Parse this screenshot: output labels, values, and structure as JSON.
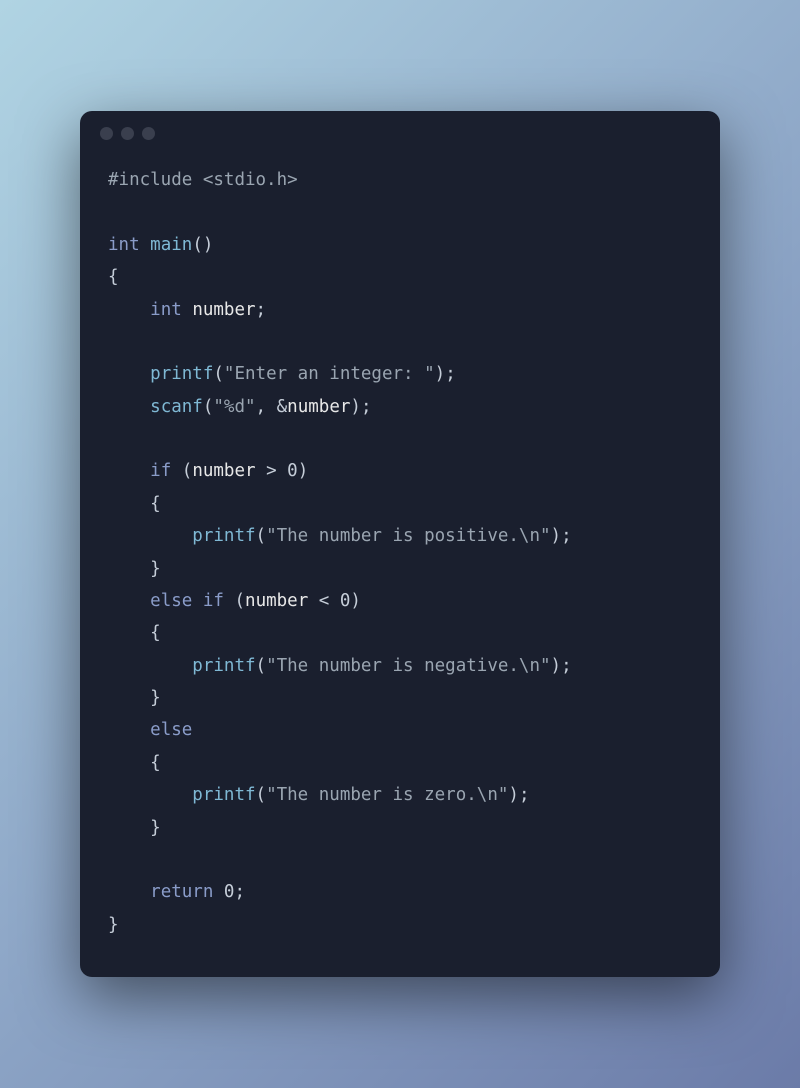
{
  "code": {
    "tokens": [
      [
        {
          "t": "#include",
          "c": "c-preprocessor"
        },
        {
          "t": " ",
          "c": "c-text"
        },
        {
          "t": "<stdio.h>",
          "c": "c-include-path"
        }
      ],
      [],
      [
        {
          "t": "int",
          "c": "c-type"
        },
        {
          "t": " ",
          "c": "c-text"
        },
        {
          "t": "main",
          "c": "c-function"
        },
        {
          "t": "()",
          "c": "c-paren"
        }
      ],
      [
        {
          "t": "{",
          "c": "c-brace"
        }
      ],
      [
        {
          "t": "    ",
          "c": "c-text"
        },
        {
          "t": "int",
          "c": "c-type"
        },
        {
          "t": " ",
          "c": "c-text"
        },
        {
          "t": "number",
          "c": "c-identifier"
        },
        {
          "t": ";",
          "c": "c-punctuation"
        }
      ],
      [],
      [
        {
          "t": "    ",
          "c": "c-text"
        },
        {
          "t": "printf",
          "c": "c-function-call"
        },
        {
          "t": "(",
          "c": "c-paren"
        },
        {
          "t": "\"Enter an integer: \"",
          "c": "c-string"
        },
        {
          "t": ")",
          "c": "c-paren"
        },
        {
          "t": ";",
          "c": "c-punctuation"
        }
      ],
      [
        {
          "t": "    ",
          "c": "c-text"
        },
        {
          "t": "scanf",
          "c": "c-function-call"
        },
        {
          "t": "(",
          "c": "c-paren"
        },
        {
          "t": "\"%d\"",
          "c": "c-string"
        },
        {
          "t": ", ",
          "c": "c-punctuation"
        },
        {
          "t": "&",
          "c": "c-operator"
        },
        {
          "t": "number",
          "c": "c-identifier"
        },
        {
          "t": ")",
          "c": "c-paren"
        },
        {
          "t": ";",
          "c": "c-punctuation"
        }
      ],
      [],
      [
        {
          "t": "    ",
          "c": "c-text"
        },
        {
          "t": "if",
          "c": "c-keyword"
        },
        {
          "t": " ",
          "c": "c-text"
        },
        {
          "t": "(",
          "c": "c-paren"
        },
        {
          "t": "number",
          "c": "c-identifier"
        },
        {
          "t": " > ",
          "c": "c-operator"
        },
        {
          "t": "0",
          "c": "c-number"
        },
        {
          "t": ")",
          "c": "c-paren"
        }
      ],
      [
        {
          "t": "    ",
          "c": "c-text"
        },
        {
          "t": "{",
          "c": "c-brace"
        }
      ],
      [
        {
          "t": "        ",
          "c": "c-text"
        },
        {
          "t": "printf",
          "c": "c-function-call"
        },
        {
          "t": "(",
          "c": "c-paren"
        },
        {
          "t": "\"The number is positive.\\n\"",
          "c": "c-string"
        },
        {
          "t": ")",
          "c": "c-paren"
        },
        {
          "t": ";",
          "c": "c-punctuation"
        }
      ],
      [
        {
          "t": "    ",
          "c": "c-text"
        },
        {
          "t": "}",
          "c": "c-brace"
        }
      ],
      [
        {
          "t": "    ",
          "c": "c-text"
        },
        {
          "t": "else",
          "c": "c-keyword"
        },
        {
          "t": " ",
          "c": "c-text"
        },
        {
          "t": "if",
          "c": "c-keyword"
        },
        {
          "t": " ",
          "c": "c-text"
        },
        {
          "t": "(",
          "c": "c-paren"
        },
        {
          "t": "number",
          "c": "c-identifier"
        },
        {
          "t": " < ",
          "c": "c-operator"
        },
        {
          "t": "0",
          "c": "c-number"
        },
        {
          "t": ")",
          "c": "c-paren"
        }
      ],
      [
        {
          "t": "    ",
          "c": "c-text"
        },
        {
          "t": "{",
          "c": "c-brace"
        }
      ],
      [
        {
          "t": "        ",
          "c": "c-text"
        },
        {
          "t": "printf",
          "c": "c-function-call"
        },
        {
          "t": "(",
          "c": "c-paren"
        },
        {
          "t": "\"The number is negative.\\n\"",
          "c": "c-string"
        },
        {
          "t": ")",
          "c": "c-paren"
        },
        {
          "t": ";",
          "c": "c-punctuation"
        }
      ],
      [
        {
          "t": "    ",
          "c": "c-text"
        },
        {
          "t": "}",
          "c": "c-brace"
        }
      ],
      [
        {
          "t": "    ",
          "c": "c-text"
        },
        {
          "t": "else",
          "c": "c-keyword"
        }
      ],
      [
        {
          "t": "    ",
          "c": "c-text"
        },
        {
          "t": "{",
          "c": "c-brace"
        }
      ],
      [
        {
          "t": "        ",
          "c": "c-text"
        },
        {
          "t": "printf",
          "c": "c-function-call"
        },
        {
          "t": "(",
          "c": "c-paren"
        },
        {
          "t": "\"The number is zero.\\n\"",
          "c": "c-string"
        },
        {
          "t": ")",
          "c": "c-paren"
        },
        {
          "t": ";",
          "c": "c-punctuation"
        }
      ],
      [
        {
          "t": "    ",
          "c": "c-text"
        },
        {
          "t": "}",
          "c": "c-brace"
        }
      ],
      [],
      [
        {
          "t": "    ",
          "c": "c-text"
        },
        {
          "t": "return",
          "c": "c-keyword"
        },
        {
          "t": " ",
          "c": "c-text"
        },
        {
          "t": "0",
          "c": "c-number"
        },
        {
          "t": ";",
          "c": "c-punctuation"
        }
      ],
      [
        {
          "t": "}",
          "c": "c-brace"
        }
      ]
    ]
  }
}
